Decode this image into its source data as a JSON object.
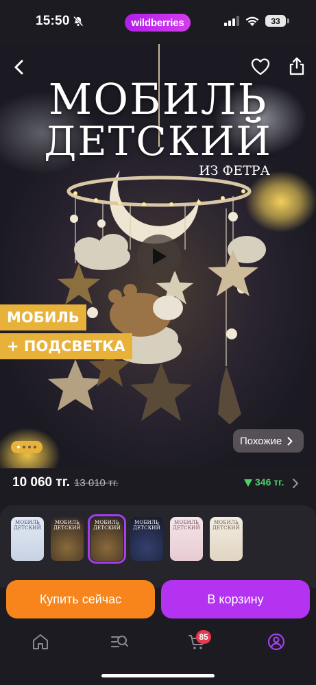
{
  "status_bar": {
    "time": "15:50",
    "brand": "wildberries",
    "battery": "33"
  },
  "hero": {
    "title_line1": "МОБИЛЬ",
    "title_line2": "ДЕТСКИЙ",
    "subtitle": "ИЗ ФЕТРА",
    "badge1": "МОБИЛЬ",
    "badge2": "+ ПОДСВЕТКА",
    "similar_label": "Похожие",
    "pager": {
      "count": 4,
      "active": 0
    }
  },
  "price": {
    "current": "10 060 тг.",
    "old": "13 010 тг.",
    "discount": "346 тг.",
    "discount_color": "#4fd16a"
  },
  "thumbnails": [
    {
      "text": "МОБИЛЬ ДЕТСКИЙ",
      "style": "light",
      "selected": false
    },
    {
      "text": "МОБИЛЬ ДЕТСКИЙ",
      "style": "dark-gold",
      "selected": false
    },
    {
      "text": "МОБИЛЬ ДЕТСКИЙ",
      "style": "dark-gold",
      "selected": true
    },
    {
      "text": "МОБИЛЬ ДЕТСКИЙ",
      "style": "dark-blue",
      "selected": false
    },
    {
      "text": "МОБИЛЬ ДЕТСКИЙ",
      "style": "pink",
      "selected": false
    },
    {
      "text": "МОБИЛЬ ДЕТСКИЙ",
      "style": "beige",
      "selected": false
    }
  ],
  "actions": {
    "buy_now": "Купить сейчас",
    "add_to_cart": "В корзину"
  },
  "tabbar": {
    "cart_count": "85",
    "accent": "#a43ff0"
  },
  "colors": {
    "brand_purple": "#b333f0",
    "buy_orange": "#f7851c",
    "badge_gold": "#e8b23a"
  }
}
